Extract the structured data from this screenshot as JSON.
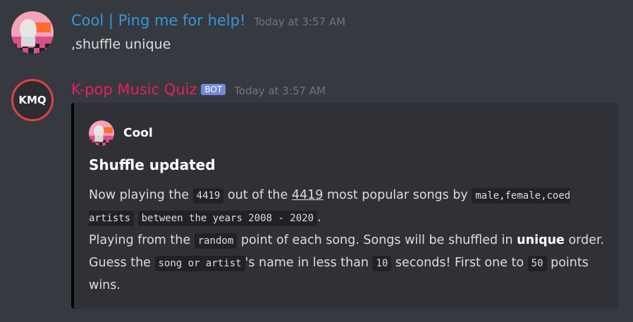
{
  "message1": {
    "username": "Cool | Ping me for help!",
    "username_color": "#3498db",
    "timestamp": "Today at 3:57 AM",
    "content": ",shuffle unique"
  },
  "message2": {
    "username": "K-pop Music Quiz",
    "username_color": "#e91e63",
    "bot_tag": "BOT",
    "timestamp": "Today at 3:57 AM",
    "avatar_text": "KMQ",
    "embed": {
      "author_name": "Cool",
      "title": "Shuffle updated",
      "desc": {
        "t1": "Now playing the ",
        "c1": "4419",
        "t2": " out of the ",
        "link": "4419",
        "t3": " most popular songs by ",
        "c2": "male,female,coed artists",
        "t4": " ",
        "c3": "between the years 2008 - 2020",
        "t5": ".",
        "t6": "Playing from the ",
        "c4": "random",
        "t7": " point of each song. Songs will be shuffled in ",
        "b1": "unique",
        "t8": " order.",
        "t9": "Guess the ",
        "c5": "song or artist",
        "t10": "'s name in less than ",
        "c6": "10",
        "t11": " seconds! First one to ",
        "c7": "50",
        "t12": " points wins."
      }
    }
  }
}
